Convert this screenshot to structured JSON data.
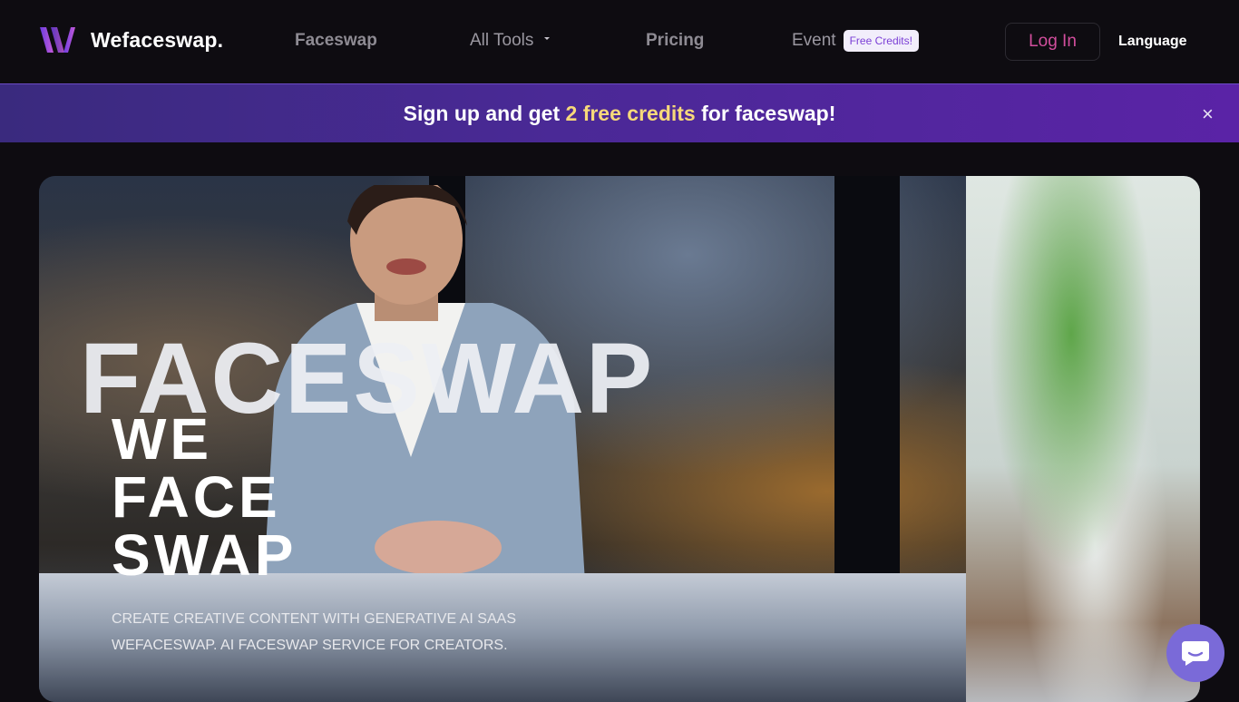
{
  "header": {
    "brand": "Wefaceswap.",
    "nav": {
      "faceswap": "Faceswap",
      "all_tools": "All Tools",
      "pricing": "Pricing",
      "event": "Event",
      "event_badge": "Free Credits!"
    },
    "login": "Log In",
    "language": "Language"
  },
  "banner": {
    "text_before": "Sign up and get ",
    "highlight": "2 free credits",
    "text_after": " for faceswap!",
    "close": "×"
  },
  "hero": {
    "overlay_word": "FACESWAP",
    "title_lines": [
      "WE",
      "FACE",
      "SWAP"
    ],
    "subtitle_lines": [
      "CREATE CREATIVE CONTENT WITH GENERATIVE AI SAAS",
      "WEFACESWAP. AI FACESWAP SERVICE FOR CREATORS."
    ]
  },
  "colors": {
    "accent": "#d24e9d",
    "banner_highlight": "#f7d97a",
    "chat_button": "#7a6ad8"
  },
  "icons": {
    "logo": "wefaceswap-logo-icon",
    "close": "close-icon",
    "chat": "chat-bubble-icon",
    "dropdown": "chevron-down-icon"
  }
}
